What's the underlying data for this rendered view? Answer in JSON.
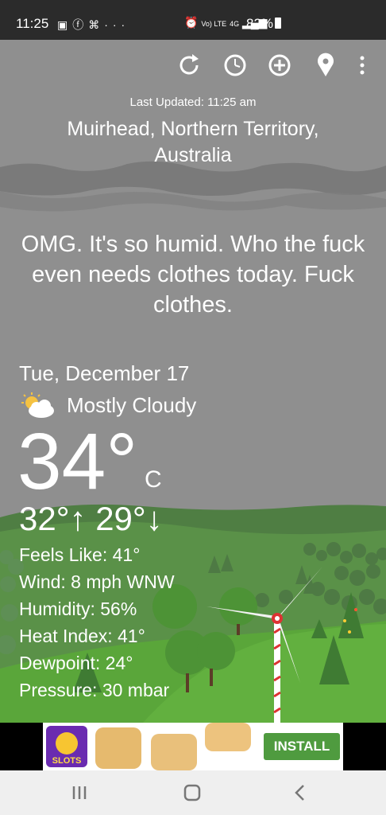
{
  "status_bar": {
    "time": "11:25",
    "icons_left": [
      "image-icon",
      "facebook-icon",
      "ticket-icon",
      "more-icon"
    ],
    "icons_right": [
      "alarm-icon",
      "volte-icon",
      "4g-icon",
      "signal-icon"
    ],
    "volte_text": "Vo) LTE",
    "net_text": "4G",
    "battery": "82%"
  },
  "toolbar": {
    "actions": [
      "refresh-icon",
      "history-icon",
      "add-location-icon",
      "location-pin-icon",
      "overflow-menu-icon"
    ]
  },
  "header": {
    "last_updated": "Last Updated: 11:25 am",
    "location": "Muirhead, Northern Territory, Australia"
  },
  "quip": "OMG. It's so humid. Who the fuck even needs clothes today. Fuck clothes.",
  "weather": {
    "date": "Tue, December 17",
    "condition": "Mostly Cloudy",
    "condition_icon": "partly-cloudy-icon",
    "temperature": "34°",
    "unit": "C",
    "high": "32°",
    "low": "29°",
    "stats": {
      "feels_like": "Feels Like: 41°",
      "wind": "Wind: 8 mph WNW",
      "humidity": "Humidity: 56%",
      "heat_index": "Heat Index: 41°",
      "dewpoint": "Dewpoint: 24°",
      "pressure": "Pressure: 30 mbar"
    }
  },
  "ad": {
    "app_icon_text": "SLOTS",
    "button": "INSTALL",
    "button_color": "#4f9b3f"
  },
  "nav_bar": {
    "buttons": [
      "recent-apps-icon",
      "home-icon",
      "back-icon"
    ]
  },
  "colors": {
    "sky": "#8e8e8e",
    "hill": "#5f9a4a",
    "status_bar": "#2b2b2b"
  }
}
